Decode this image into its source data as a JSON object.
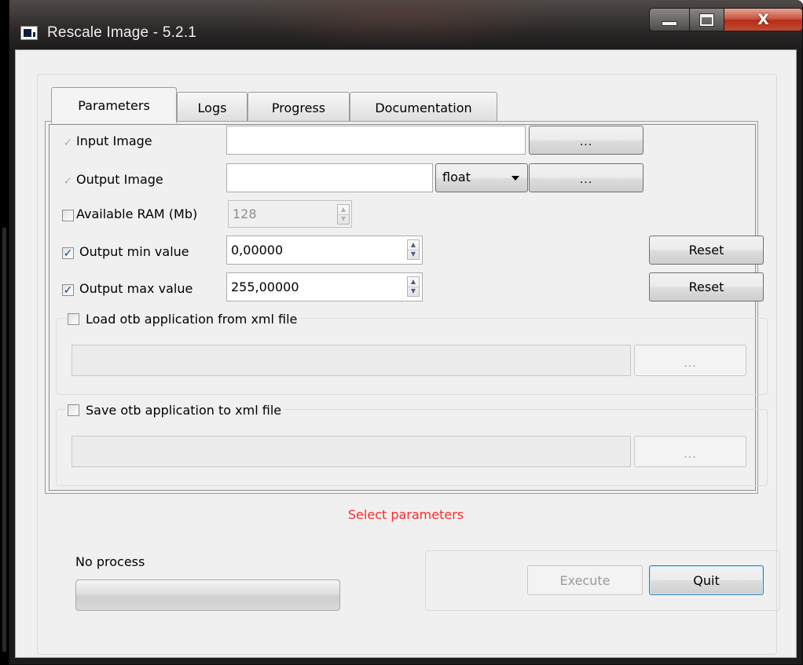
{
  "window": {
    "title": "Rescale Image - 5.2.1",
    "close_glyph": "X"
  },
  "tabs": [
    {
      "label": "Parameters",
      "active": true
    },
    {
      "label": "Logs",
      "active": false
    },
    {
      "label": "Progress",
      "active": false
    },
    {
      "label": "Documentation",
      "active": false
    }
  ],
  "params": {
    "input_image": {
      "label": "Input Image",
      "value": "",
      "browse_label": "..."
    },
    "output_image": {
      "label": "Output Image",
      "value": "",
      "pixel_type": "float",
      "browse_label": "..."
    },
    "available_ram": {
      "label": "Available RAM (Mb)",
      "value": "128",
      "checked": false
    },
    "output_min": {
      "label": "Output min value",
      "value": "0,00000",
      "checked": true,
      "reset_label": "Reset"
    },
    "output_max": {
      "label": "Output max value",
      "value": "255,00000",
      "checked": true,
      "reset_label": "Reset"
    }
  },
  "xml": {
    "load": {
      "label": "Load otb application from xml file",
      "checked": false,
      "browse_label": "..."
    },
    "save": {
      "label": "Save otb application to xml file",
      "checked": false,
      "browse_label": "..."
    }
  },
  "status": {
    "message": "Select parameters",
    "message_color": "#ff2a2a",
    "process_label": "No process"
  },
  "actions": {
    "execute_label": "Execute",
    "quit_label": "Quit"
  },
  "icons": {
    "check": "✓",
    "spin_up": "▲",
    "spin_down": "▼"
  }
}
